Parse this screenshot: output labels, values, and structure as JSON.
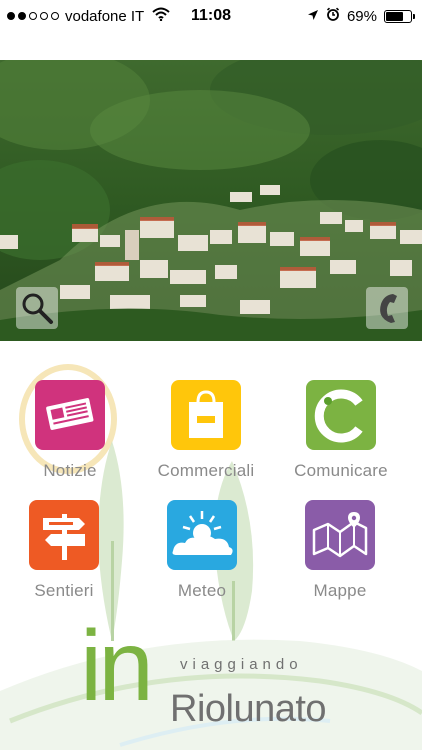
{
  "status_bar": {
    "carrier": "vodafone IT",
    "time": "11:08",
    "battery_percent": "69%",
    "battery_level": 0.69,
    "signal_bars_filled": 2,
    "signal_bars_total": 5,
    "icons": [
      "wifi-icon",
      "location-arrow-icon",
      "alarm-icon",
      "battery-icon"
    ]
  },
  "hero": {
    "image": "village-hillside-photo",
    "search_icon": "search-icon",
    "phone_icon": "phone-icon"
  },
  "menu": [
    {
      "label": "Notizie",
      "icon": "newspaper-icon",
      "color": "#d0337d"
    },
    {
      "label": "Commerciali",
      "icon": "shopping-bag-icon",
      "color": "#ffc60b"
    },
    {
      "label": "Comunicare",
      "icon": "comunicare-c-icon",
      "color": "#7cb342"
    },
    {
      "label": "Sentieri",
      "icon": "signpost-icon",
      "color": "#ee5a24"
    },
    {
      "label": "Meteo",
      "icon": "sun-cloud-icon",
      "color": "#29a8e0"
    },
    {
      "label": "Mappe",
      "icon": "map-icon",
      "color": "#8a5ca8"
    }
  ],
  "logo": {
    "prefix": "in",
    "tagline": "viaggiando",
    "town": "Riolunato",
    "prefix_color": "#7cb342",
    "text_color": "#707070"
  }
}
